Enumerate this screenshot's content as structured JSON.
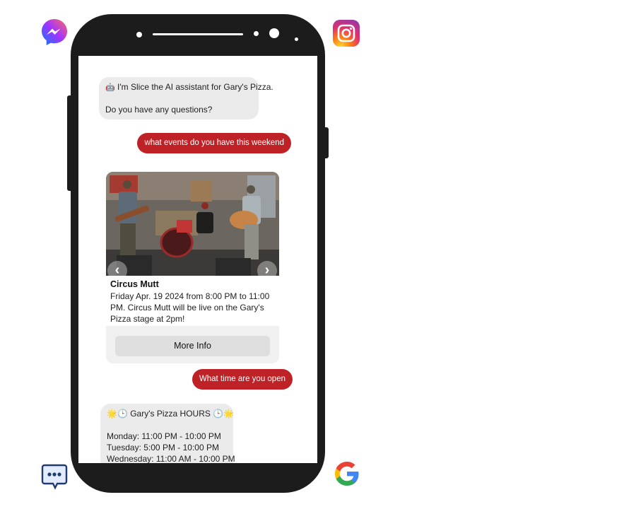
{
  "platform_icons": {
    "top_left": "messenger-icon",
    "top_right": "instagram-icon",
    "bottom_left": "sms-chat-icon",
    "bottom_right": "google-icon"
  },
  "chat": {
    "greeting": {
      "emoji": "🤖",
      "line1": "I'm Slice the AI assistant for Gary's Pizza.",
      "line2": "Do you have any questions?"
    },
    "user_message_1": "what events do you have this weekend",
    "event_card": {
      "title": "Circus Mutt",
      "description": "Friday Apr. 19 2024 from 8:00 PM to 11:00 PM. Circus Mutt will be live on the Gary's Pizza stage at 2pm!",
      "button_label": "More Info",
      "prev_arrow": "‹",
      "next_arrow": "›"
    },
    "user_message_2": "What time are you open",
    "hours": {
      "title": "🌟🕒 Gary's Pizza HOURS 🕒🌟",
      "lines": [
        "Monday: 11:00 PM - 10:00 PM",
        "Tuesday: 5:00 PM - 10:00 PM",
        "Wednesday: 11:00 AM - 10:00 PM"
      ]
    }
  },
  "colors": {
    "user_bubble": "#be2227",
    "bot_bubble": "#ebebeb",
    "phone_body": "#1c1c1c"
  }
}
